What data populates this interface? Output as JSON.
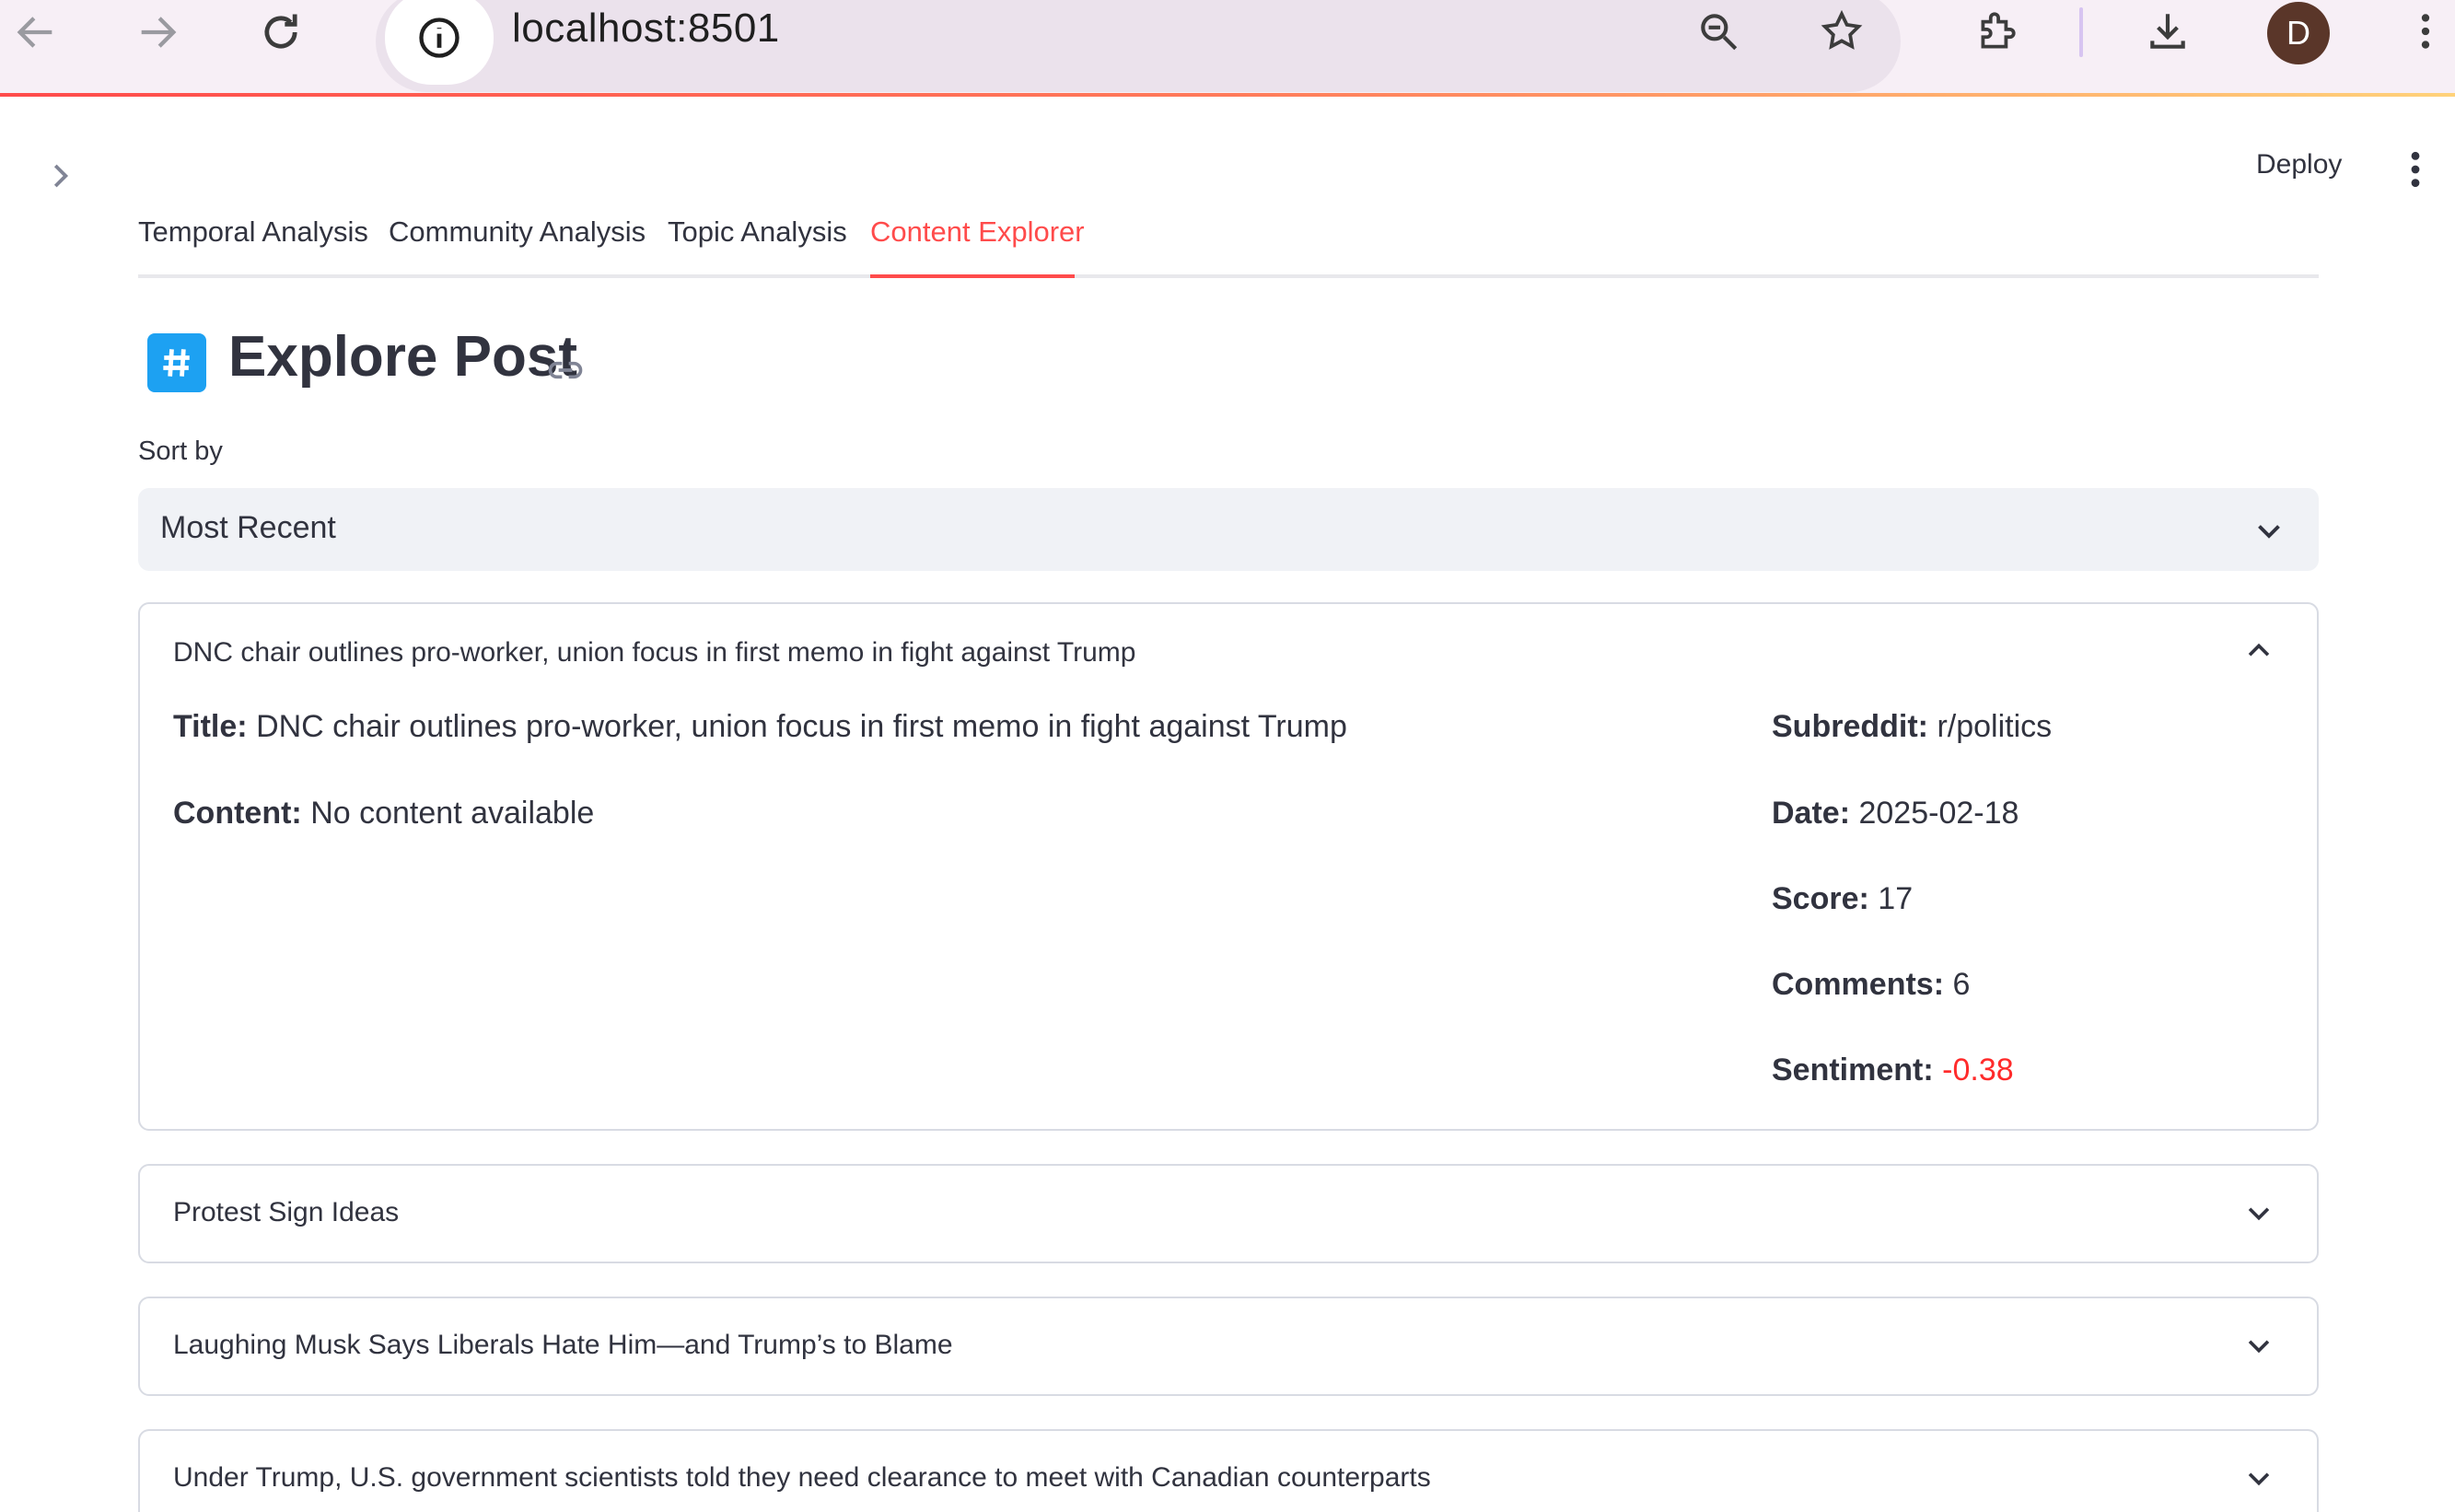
{
  "browser": {
    "url": "localhost:8501",
    "avatar_letter": "D"
  },
  "header": {
    "deploy_label": "Deploy"
  },
  "tabs": [
    {
      "label": "Temporal Analysis",
      "active": false
    },
    {
      "label": "Community Analysis",
      "active": false
    },
    {
      "label": "Topic Analysis",
      "active": false
    },
    {
      "label": "Content Explorer",
      "active": true
    }
  ],
  "page": {
    "title": "Explore Post",
    "icon": "hash-icon"
  },
  "sort": {
    "label": "Sort by",
    "selected": "Most Recent"
  },
  "posts": [
    {
      "header": "DNC chair outlines pro-worker, union focus in first memo in fight against Trump",
      "expanded": true,
      "title_label": "Title:",
      "title": "DNC chair outlines pro-worker, union focus in first memo in fight against Trump",
      "content_label": "Content:",
      "content": "No content available",
      "subreddit_label": "Subreddit:",
      "subreddit": "r/politics",
      "date_label": "Date:",
      "date": "2025-02-18",
      "score_label": "Score:",
      "score": "17",
      "comments_label": "Comments:",
      "comments": "6",
      "sentiment_label": "Sentiment:",
      "sentiment": "-0.38"
    },
    {
      "header": "Protest Sign Ideas",
      "expanded": false
    },
    {
      "header": "Laughing Musk Says Liberals Hate Him—and Trump’s to Blame",
      "expanded": false
    },
    {
      "header": "Under Trump, U.S. government scientists told they need clearance to meet with Canadian counterparts",
      "expanded": false
    }
  ],
  "colors": {
    "accent": "#ff4b4b",
    "negative": "#ff2b2b",
    "hash_icon_bg": "#1da1f2"
  }
}
